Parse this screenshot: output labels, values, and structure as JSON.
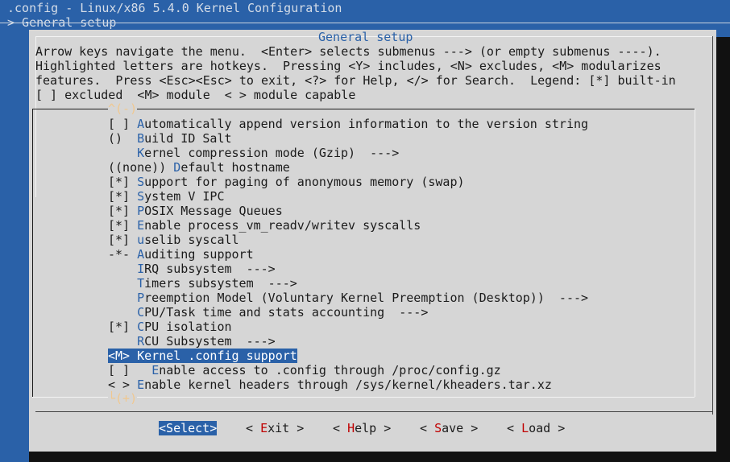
{
  "header": {
    "title": ".config - Linux/x86 5.4.0 Kernel Configuration",
    "breadcrumb": "> General setup"
  },
  "dialog": {
    "title": "General setup",
    "help_lines": [
      "Arrow keys navigate the menu.  <Enter> selects submenus ---> (or empty submenus ----).",
      "Highlighted letters are hotkeys.  Pressing <Y> includes, <N> excludes, <M> modularizes",
      "features.  Press <Esc><Esc> to exit, <?> for Help, </> for Search.  Legend: [*] built-in",
      "[ ] excluded  <M> module  < > module capable"
    ],
    "scroll_up": "^(-)",
    "scroll_down": "└(+)"
  },
  "menu": {
    "items": [
      {
        "prefix": "[ ] ",
        "hotkey": "A",
        "rest": "utomatically append version information to the version string"
      },
      {
        "prefix": "()  ",
        "hotkey": "B",
        "rest": "uild ID Salt"
      },
      {
        "prefix": "    ",
        "hotkey": "K",
        "rest": "ernel compression mode (Gzip)  --->"
      },
      {
        "prefix": "((none)) ",
        "hotkey": "D",
        "rest": "efault hostname"
      },
      {
        "prefix": "[*] ",
        "hotkey": "S",
        "rest": "upport for paging of anonymous memory (swap)"
      },
      {
        "prefix": "[*] ",
        "hotkey": "S",
        "rest": "ystem V IPC"
      },
      {
        "prefix": "[*] ",
        "hotkey": "P",
        "rest": "OSIX Message Queues"
      },
      {
        "prefix": "[*] ",
        "hotkey": "E",
        "rest": "nable process_vm_readv/writev syscalls"
      },
      {
        "prefix": "[*] ",
        "hotkey": "u",
        "rest": "selib syscall"
      },
      {
        "prefix": "-*- ",
        "hotkey": "A",
        "rest": "uditing support"
      },
      {
        "prefix": "    ",
        "hotkey": "I",
        "rest": "RQ subsystem  --->"
      },
      {
        "prefix": "    ",
        "hotkey": "T",
        "rest": "imers subsystem  --->"
      },
      {
        "prefix": "    ",
        "hotkey": "P",
        "rest": "reemption Model (Voluntary Kernel Preemption (Desktop))  --->"
      },
      {
        "prefix": "    ",
        "hotkey": "C",
        "rest": "PU/Task time and stats accounting  --->"
      },
      {
        "prefix": "[*] ",
        "hotkey": "C",
        "rest": "PU isolation"
      },
      {
        "prefix": "    ",
        "hotkey": "R",
        "rest": "CU Subsystem  --->"
      },
      {
        "prefix": "<M> ",
        "hotkey": "K",
        "rest": "ernel .config support"
      },
      {
        "prefix": "[ ]   ",
        "hotkey": "E",
        "rest": "nable access to .config through /proc/config.gz"
      },
      {
        "prefix": "< > ",
        "hotkey": "E",
        "rest": "nable kernel headers through /sys/kernel/kheaders.tar.xz"
      }
    ]
  },
  "buttons": {
    "select": {
      "left": "<",
      "hotkey": "S",
      "rest": "elect",
      "right": ">"
    },
    "exit": {
      "left": "< ",
      "hotkey": "E",
      "rest": "xit",
      "right": " >"
    },
    "help": {
      "left": "< ",
      "hotkey": "H",
      "rest": "elp",
      "right": " >"
    },
    "save": {
      "left": "< ",
      "hotkey": "S",
      "rest": "ave",
      "right": " >"
    },
    "load": {
      "left": "< ",
      "hotkey": "L",
      "rest": "oad",
      "right": " >"
    }
  },
  "colors": {
    "background": "#2a61a8",
    "dialog": "#d6d6d6",
    "highlight": "#2a61a8",
    "button_hotkey": "#c00000"
  }
}
